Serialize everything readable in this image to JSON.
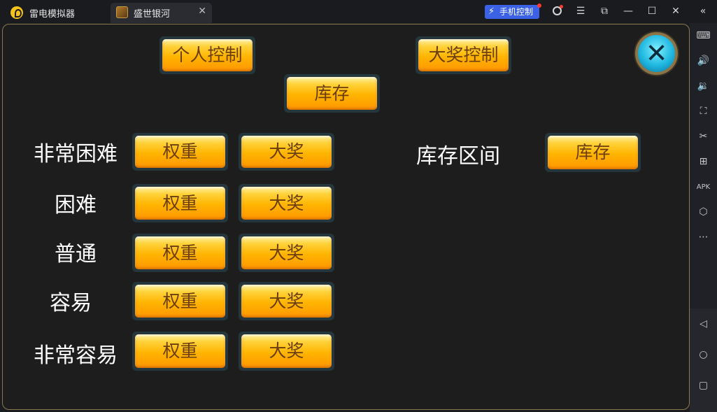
{
  "window": {
    "app_title": "雷电模拟器",
    "tab_label": "盛世银河",
    "phone_control_label": "手机控制"
  },
  "top_buttons": {
    "personal_control": "个人控制",
    "jackpot_control": "大奖控制",
    "inventory": "库存"
  },
  "rows": [
    {
      "label": "非常困难",
      "weight": "权重",
      "jackpot": "大奖"
    },
    {
      "label": "困难",
      "weight": "权重",
      "jackpot": "大奖"
    },
    {
      "label": "普通",
      "weight": "权重",
      "jackpot": "大奖"
    },
    {
      "label": "容易",
      "weight": "权重",
      "jackpot": "大奖"
    },
    {
      "label": "非常容易",
      "weight": "权重",
      "jackpot": "大奖"
    }
  ],
  "inventory_range": {
    "label": "库存区间",
    "button": "库存"
  },
  "icons": {
    "close": "close-icon",
    "keyboard": "keyboard-icon",
    "volume_up": "volume-up-icon",
    "volume_down": "volume-down-icon",
    "screenshot": "screenshot-icon",
    "scissors": "scissors-icon",
    "add": "add-icon",
    "apk": "apk-icon",
    "settings": "settings-icon",
    "more": "more-icon",
    "back": "back-icon",
    "home": "home-icon",
    "recent": "recent-apps-icon"
  },
  "colors": {
    "button_gradient_top": "#ffd23a",
    "button_gradient_bottom": "#ff9600",
    "button_text": "#6b3e0c",
    "accent_blue": "#3a61e6"
  }
}
